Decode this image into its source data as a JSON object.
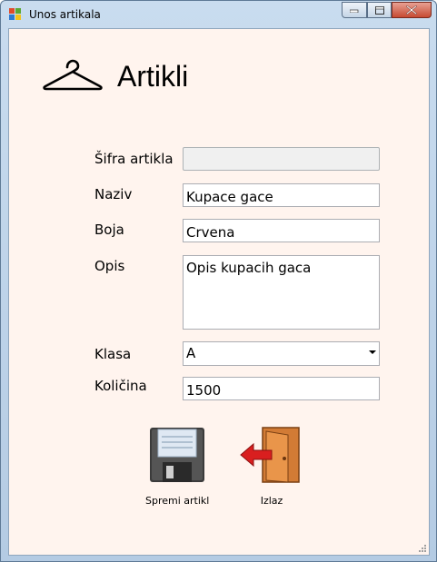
{
  "window": {
    "title": "Unos artikala",
    "minimize_icon": "minimize-icon",
    "maximize_icon": "maximize-icon",
    "close_icon": "close-icon"
  },
  "header": {
    "title": "Artikli",
    "icon": "hanger-icon"
  },
  "form": {
    "sifra": {
      "label": "Šifra artikla",
      "value": ""
    },
    "naziv": {
      "label": "Naziv",
      "value": "Kupace gace"
    },
    "boja": {
      "label": "Boja",
      "value": "Crvena"
    },
    "opis": {
      "label": "Opis",
      "value": "Opis kupacih gaca"
    },
    "klasa": {
      "label": "Klasa",
      "value": "A"
    },
    "kolicina": {
      "label": "Količina",
      "value": "1500"
    }
  },
  "actions": {
    "save_label": "Spremi artikl",
    "save_icon": "floppy-disk-icon",
    "exit_label": "Izlaz",
    "exit_icon": "exit-door-icon"
  }
}
